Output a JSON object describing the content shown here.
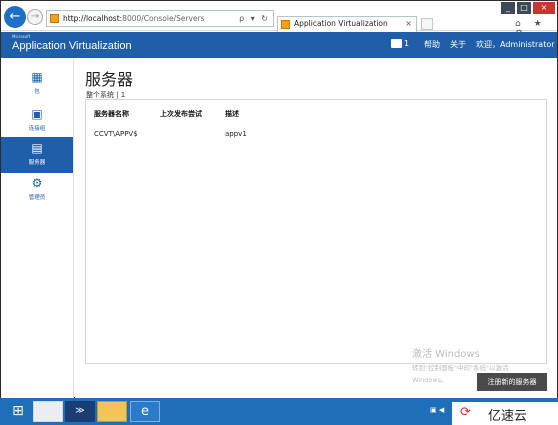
{
  "browser": {
    "url_host": "http://localhost:",
    "url_path": "8000/Console/Servers",
    "url_tools": "ρ ▾ ↻",
    "tab_title": "Application Virtualization",
    "tab_close": "×",
    "back": "←",
    "forward": "→",
    "window_min": "_",
    "window_max": "□",
    "window_close": "×",
    "chrome_icons": "⌂ ★ ⚙"
  },
  "header": {
    "brand_small": "Microsoft",
    "brand": "Application Virtualization",
    "notification_count": "1",
    "help": "帮助",
    "about": "关于",
    "welcome": "欢迎，Administrator"
  },
  "sidebar": {
    "items": [
      {
        "icon": "▦",
        "label": "包"
      },
      {
        "icon": "▣",
        "label": "连接组"
      },
      {
        "icon": "▤",
        "label": "服务器"
      },
      {
        "icon": "⚙",
        "label": "管理员"
      }
    ]
  },
  "main": {
    "title": "服务器",
    "scope": "整个系统 | 1",
    "columns": [
      "服务器名称",
      "上次发布尝试",
      "描述"
    ],
    "rows": [
      {
        "name": "CCVT\\APPV$",
        "last_publish": "",
        "description": "appv1"
      }
    ],
    "register_button": "注册新的服务器",
    "activate_title": "激活 Windows",
    "activate_text": "转到\"控制面板\"中的\"系统\"以激活",
    "activate_text2": "Windows。"
  },
  "taskbar": {
    "start": "⊞",
    "powershell": "≫",
    "ie": "e",
    "tray": "▣ ◀"
  },
  "watermark": {
    "mark": "⟳",
    "text": "亿速云"
  },
  "colors": {
    "accent": "#1f5ea8",
    "taskbar": "#1e6fb8",
    "button": "#4a4a4a"
  }
}
